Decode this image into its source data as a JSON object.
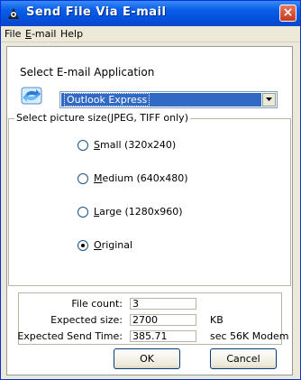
{
  "window": {
    "title": "Send File Via E-mail",
    "close_glyph": "×"
  },
  "menubar": {
    "file": "File",
    "email_hotkey": "E",
    "email_rest": "-mail",
    "help": "Help"
  },
  "email_app": {
    "label": "Select E-mail Application",
    "selected": "Outlook Express",
    "icon": "email-client-icon"
  },
  "picture_size": {
    "legend": "Select picture size(JPEG, TIFF only)",
    "options": [
      {
        "hotkey": "S",
        "rest": "mall (320x240)",
        "checked": false
      },
      {
        "hotkey": "M",
        "rest": "edium (640x480)",
        "checked": false
      },
      {
        "hotkey": "L",
        "rest": "arge (1280x960)",
        "checked": false
      },
      {
        "hotkey": "O",
        "rest": "riginal",
        "checked": true
      }
    ]
  },
  "stats": {
    "file_count_label": "File count:",
    "file_count": "3",
    "expected_size_label": "Expected size:",
    "expected_size": "2700",
    "expected_size_unit": "KB",
    "send_time_label": "Expected Send Time:",
    "send_time": "385.71",
    "send_time_unit": "sec 56K Modem"
  },
  "buttons": {
    "ok": "OK",
    "cancel": "Cancel"
  },
  "colors": {
    "titlebar": "#0a5ee8",
    "selection": "#316ac5",
    "close": "#c4391e",
    "dialog_bg": "#ece9d8"
  }
}
